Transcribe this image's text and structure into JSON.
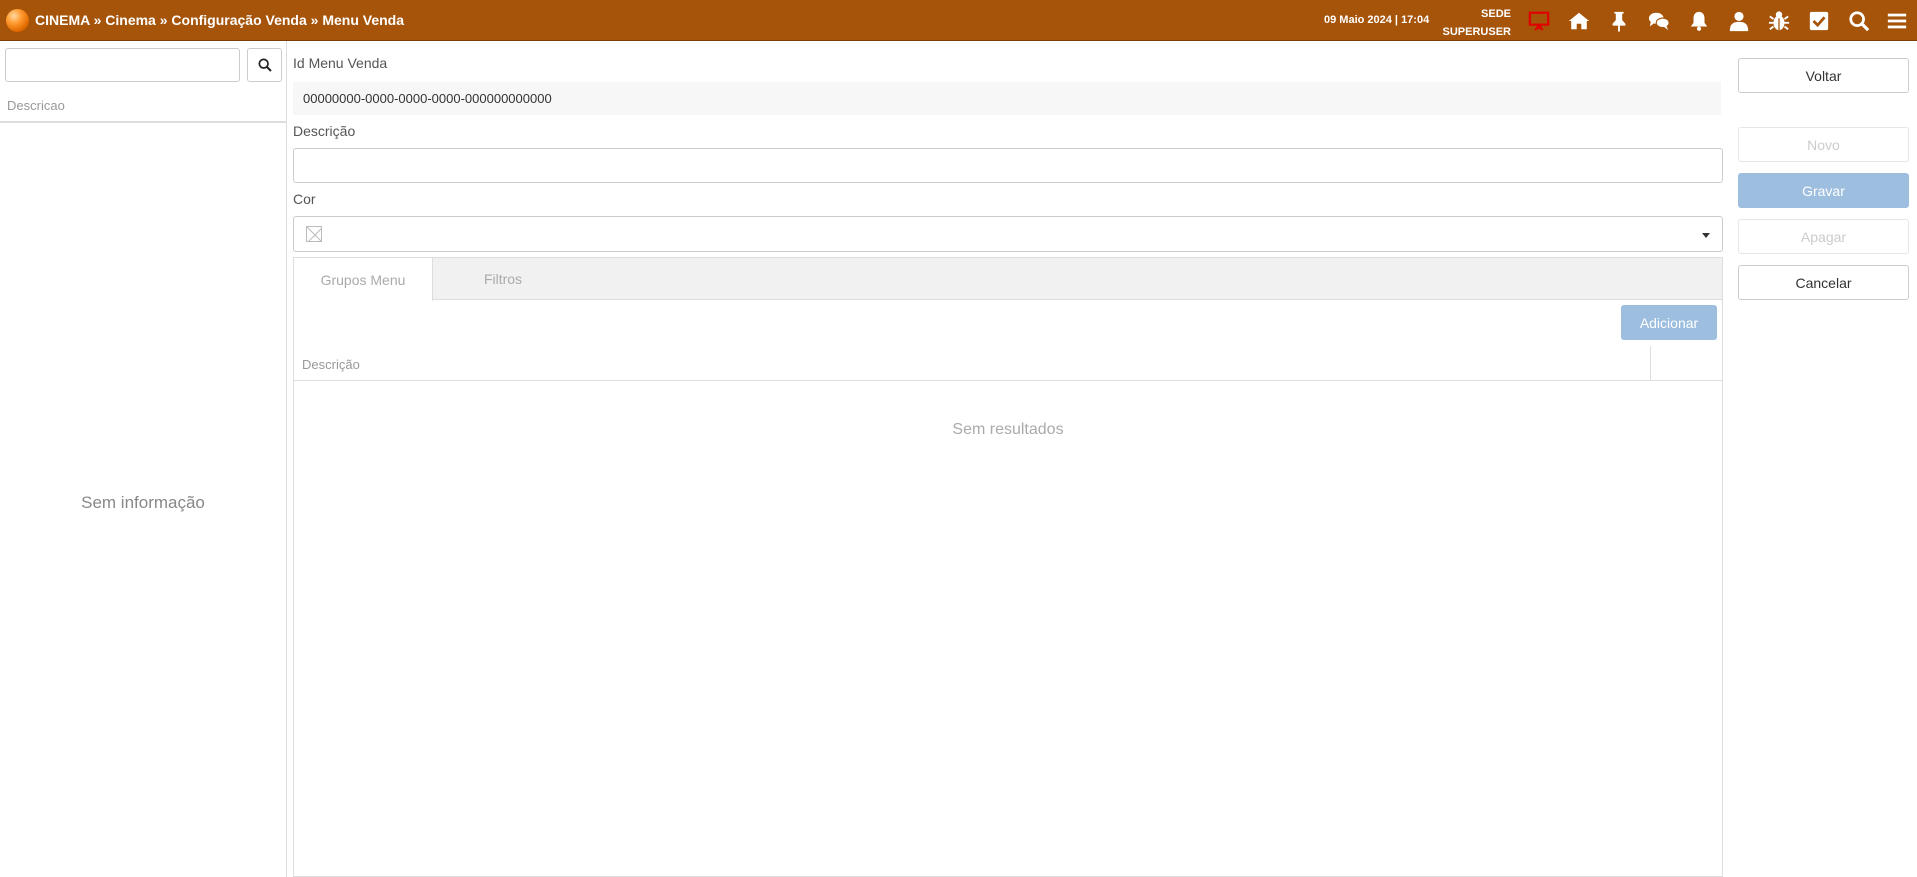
{
  "header": {
    "breadcrumb": "CINEMA » Cinema » Configuração Venda » Menu Venda",
    "datetime": "09 Maio 2024 | 17:04",
    "site": "SEDE",
    "user": "SUPERUSER",
    "icons": [
      "monitor-icon",
      "home-icon",
      "pin-icon",
      "chat-icon",
      "bell-icon",
      "user-icon",
      "bug-icon",
      "checkbox-icon",
      "search-icon",
      "menu-icon"
    ],
    "colors": {
      "bar": "#a5540a",
      "monitor_icon": "#e00000"
    }
  },
  "sidebar": {
    "search_placeholder": "",
    "column": "Descricao",
    "empty": "Sem informação"
  },
  "form": {
    "id_label": "Id Menu Venda",
    "id_value": "00000000-0000-0000-0000-000000000000",
    "descricao_label": "Descrição",
    "descricao_value": "",
    "cor_label": "Cor"
  },
  "tabs": {
    "items": [
      "Grupos Menu",
      "Filtros"
    ],
    "add_label": "Adicionar",
    "column": "Descrição",
    "empty": "Sem resultados"
  },
  "actions": {
    "voltar": "Voltar",
    "novo": "Novo",
    "gravar": "Gravar",
    "apagar": "Apagar",
    "cancelar": "Cancelar"
  }
}
